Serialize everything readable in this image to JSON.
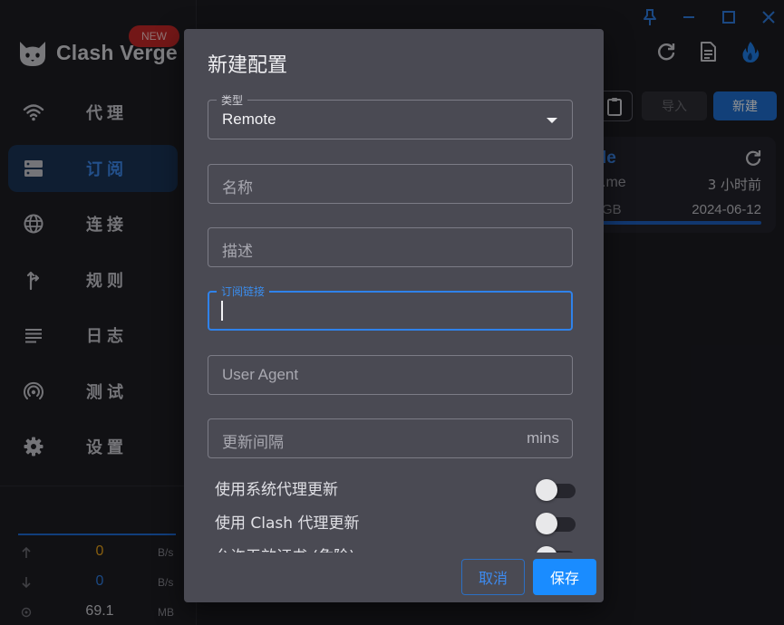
{
  "app": {
    "name": "Clash Verge",
    "badge": "NEW"
  },
  "sidebar": {
    "items": [
      {
        "label": "代理",
        "icon": "wifi-icon",
        "active": false
      },
      {
        "label": "订阅",
        "icon": "server-icon",
        "active": true
      },
      {
        "label": "连接",
        "icon": "globe-icon",
        "active": false
      },
      {
        "label": "规则",
        "icon": "fork-arrow-icon",
        "active": false
      },
      {
        "label": "日志",
        "icon": "list-lines-icon",
        "active": false
      },
      {
        "label": "测试",
        "icon": "broadcast-icon",
        "active": false
      },
      {
        "label": "设置",
        "icon": "gear-icon",
        "active": false
      }
    ],
    "traffic": {
      "upload": {
        "value": "0",
        "unit": "B/s"
      },
      "download": {
        "value": "0",
        "unit": "B/s"
      },
      "memory": {
        "value": "69.1",
        "unit": "MB"
      }
    }
  },
  "toolbar": {
    "import_label": "导入",
    "new_label": "新建"
  },
  "profile_card": {
    "name": "le",
    "domain": ".me",
    "updated_ago": "3 小时前",
    "size": "GB",
    "expire": "2024-06-12"
  },
  "dialog": {
    "title": "新建配置",
    "type_field": {
      "legend": "类型",
      "value": "Remote"
    },
    "name_field": {
      "placeholder": "名称"
    },
    "desc_field": {
      "placeholder": "描述"
    },
    "url_field": {
      "legend": "订阅链接",
      "value": ""
    },
    "ua_field": {
      "placeholder": "User Agent"
    },
    "interval_field": {
      "placeholder": "更新间隔",
      "suffix": "mins"
    },
    "switches": [
      {
        "label": "使用系统代理更新",
        "on": false
      },
      {
        "label": "使用 Clash 代理更新",
        "on": false
      },
      {
        "label": "允许无效证书 (危险)",
        "on": false
      }
    ],
    "cancel_label": "取消",
    "save_label": "保存"
  },
  "colors": {
    "accent": "#1a8cff",
    "active_nav_bg": "#1b3556",
    "new_badge": "#c62828",
    "upload": "#e8a21b",
    "download": "#2f7de1"
  }
}
